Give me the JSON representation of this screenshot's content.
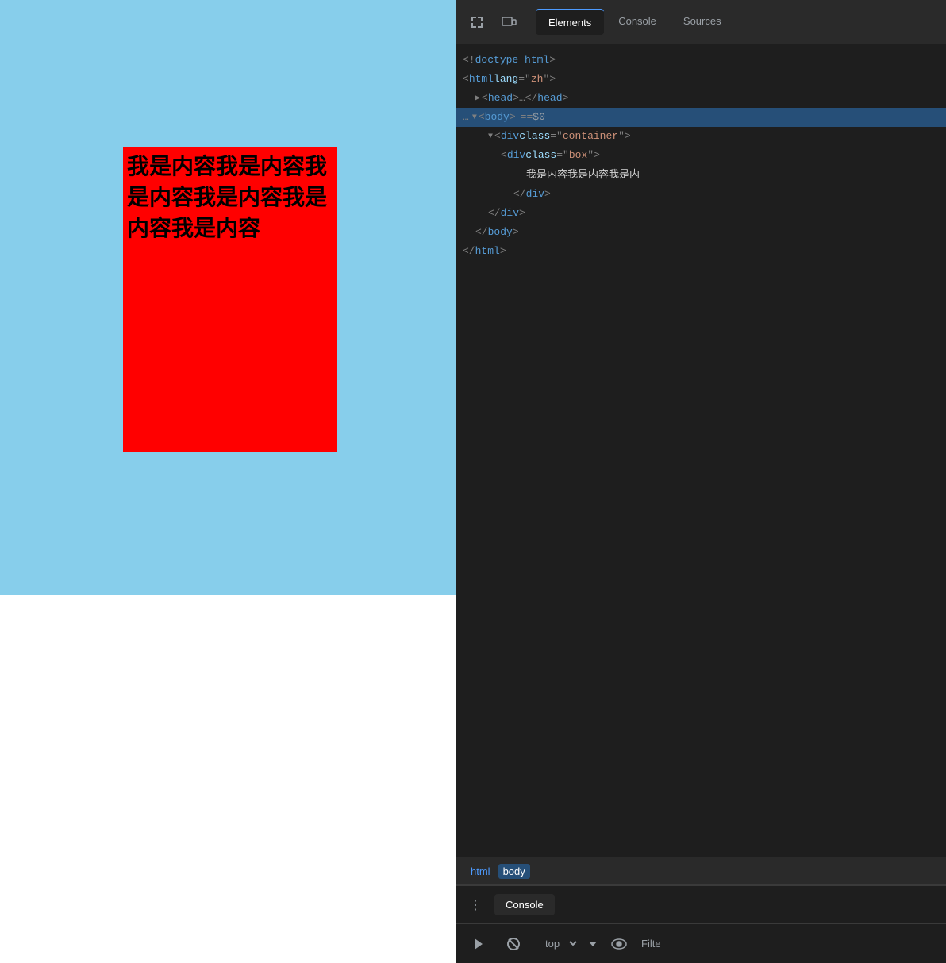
{
  "browser": {
    "box_text": "我是内容我是内容我是内容我是内容我是内容我是内容"
  },
  "devtools": {
    "tabs": [
      {
        "id": "elements",
        "label": "Elements",
        "active": true
      },
      {
        "id": "console",
        "label": "Console",
        "active": false
      },
      {
        "id": "sources",
        "label": "Sources",
        "active": false
      }
    ],
    "toolbar": {
      "inspect_icon": "⬚",
      "device_icon": "▭"
    },
    "dom": {
      "doctype": "<!doctype html>",
      "html_open": "<html lang=\"zh\">",
      "head": "▶ <head>…</head>",
      "body_open": "▼ <body> == $0",
      "container_open": "▼ <div class=\"container\">",
      "box_open": "<div class=\"box\">",
      "box_text": "我是内容我是内容我是内",
      "box_close": "</div>",
      "container_close": "</div>",
      "body_close": "</body>",
      "html_close": "</html>"
    },
    "breadcrumb": {
      "items": [
        {
          "label": "html",
          "active": false
        },
        {
          "label": "body",
          "active": false
        }
      ]
    },
    "console_label": "Console",
    "console_bar": {
      "top_label": "top",
      "filter_label": "Filte"
    }
  }
}
